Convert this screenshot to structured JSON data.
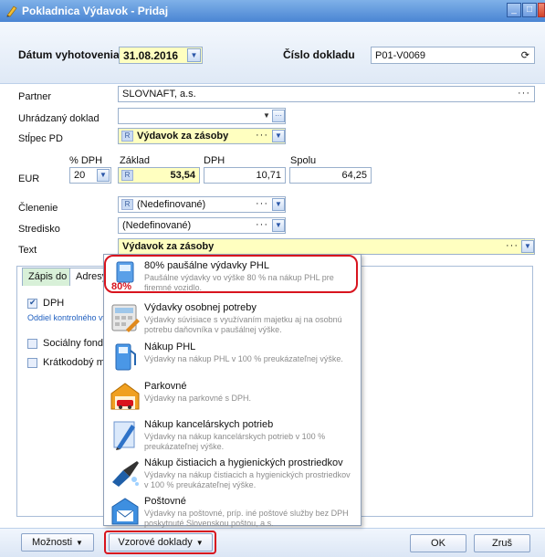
{
  "window": {
    "title": "Pokladnica Výdavok - Pridaj",
    "minimize": "_",
    "maximize": "□",
    "close": "X"
  },
  "header": {
    "date_label": "Dátum vyhotovenia",
    "date_value": "31.08.2016",
    "docno_label": "Číslo dokladu",
    "docno_value": "P01-V0069",
    "refresh_icon": "⟳"
  },
  "form": {
    "partner_label": "Partner",
    "partner_value": "SLOVNAFT, a.s.",
    "uhradzany_label": "Uhrádzaný doklad",
    "uhradzany_value": "",
    "stlpec_label": "Stĺpec PD",
    "stlpec_badge": "R",
    "stlpec_value": "Výdavok za zásoby",
    "ellipsis": "···",
    "currency": "EUR",
    "vat_pct_label": "% DPH",
    "vat_pct_value": "20",
    "zaklad_label": "Základ",
    "zaklad_badge": "R",
    "zaklad_value": "53,54",
    "dph_label": "DPH",
    "dph_value": "10,71",
    "spolu_label": "Spolu",
    "spolu_value": "64,25",
    "clenenie_label": "Členenie",
    "clenenie_badge": "R",
    "clenenie_value": "(Nedefinované)",
    "stredisko_label": "Stredisko",
    "stredisko_value": "(Nedefinované)",
    "text_label": "Text",
    "text_value": "Výdavok za zásoby"
  },
  "tabs": [
    {
      "label": "Zápis do"
    },
    {
      "label": "Adresy"
    }
  ],
  "panel": {
    "dph_check": "DPH",
    "oddiel_link": "Oddiel kontrolného vy",
    "socialny_fond": "Sociálny fond",
    "kratkodoby": "Krátkodobý ma"
  },
  "popup_items": [
    {
      "title": "80% paušálne výdavky PHL",
      "desc": "Paušálne výdavky vo výške 80 % na nákup PHL pre firemné vozidlo.",
      "icon_text": "80%"
    },
    {
      "title": "Výdavky osobnej potreby",
      "desc": "Výdavky súvisiace s využívaním majetku aj na osobnú potrebu daňovníka v paušálnej výške."
    },
    {
      "title": "Nákup PHL",
      "desc": "Výdavky na nákup PHL v 100 % preukázateľnej výške."
    },
    {
      "title": "Parkovné",
      "desc": "Výdavky na parkovné s DPH."
    },
    {
      "title": "Nákup kancelárskych potrieb",
      "desc": "Výdavky na nákup kancelárskych potrieb v 100 % preukázateľnej výške."
    },
    {
      "title": "Nákup čistiacich a hygienických prostriedkov",
      "desc": "Výdavky na nákup čistiacich a hygienických prostriedkov v 100 % preukázateľnej výške."
    },
    {
      "title": "Poštovné",
      "desc": "Výdavky na poštovné, príp. iné poštové služby bez DPH poskytnuté Slovenskou poštou, a.s."
    }
  ],
  "bottom": {
    "moznosti": "Možnosti",
    "vzorove": "Vzorové doklady",
    "ok": "OK",
    "zrus": "Zruš"
  },
  "colors": {
    "title_bar": "#4a85d3",
    "highlight_yellow": "#ffffc0",
    "annotation_red": "#d8141e",
    "accent_blue": "#2b57a8"
  }
}
